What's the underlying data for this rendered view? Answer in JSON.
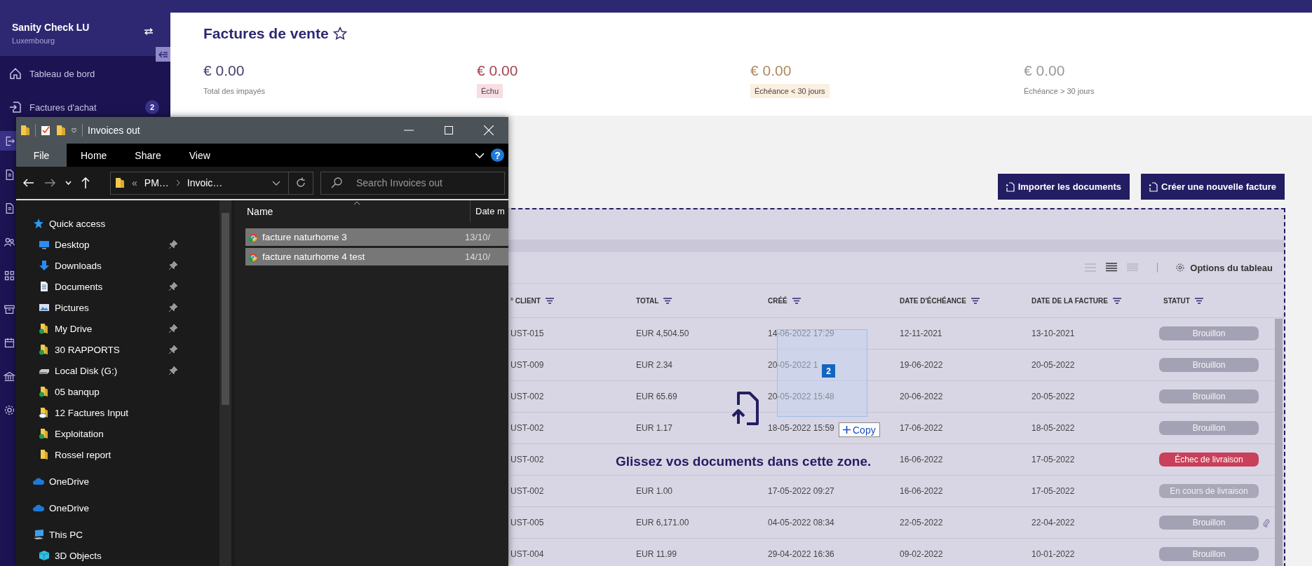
{
  "sidebar": {
    "company": "Sanity Check LU",
    "country": "Luxembourg",
    "items": [
      {
        "label": "Tableau de bord",
        "kind": "home",
        "selected": false
      },
      {
        "label": "Factures d'achat",
        "kind": "import",
        "badge": "2",
        "selected": false
      },
      {
        "kind": "export",
        "selected": true
      },
      {
        "kind": "document",
        "selected": false
      },
      {
        "kind": "document",
        "selected": false
      },
      {
        "kind": "people",
        "selected": false
      },
      {
        "kind": "grid",
        "selected": false
      },
      {
        "kind": "archive",
        "selected": false
      },
      {
        "kind": "calendar",
        "selected": false
      },
      {
        "kind": "bank",
        "selected": false
      },
      {
        "kind": "gear",
        "selected": false
      }
    ]
  },
  "page": {
    "title": "Factures de vente",
    "favorite": false,
    "stats": [
      {
        "amount": "€ 0.00",
        "label": "Total des impayés",
        "kind": "total"
      },
      {
        "amount": "€ 0.00",
        "label": "Échu",
        "kind": "overdue"
      },
      {
        "amount": "€ 0.00",
        "label": "Échéance < 30 jours",
        "kind": "soon"
      },
      {
        "amount": "€ 0.00",
        "label": "Échéance > 30 jours",
        "kind": "later"
      }
    ],
    "buttons": [
      "Importer les documents",
      "Créer une nouvelle facture"
    ]
  },
  "table": {
    "density": [
      {
        "selected": false
      },
      {
        "selected": true
      },
      {
        "selected": false
      }
    ],
    "options_label": "Options du tableau",
    "columns": [
      "° CLIENT",
      "TOTAL",
      "CRÉÉ",
      "DATE D'ÉCHÉANCE",
      "DATE DE LA FACTURE",
      "STATUT"
    ],
    "rows": [
      {
        "client": "UST-015",
        "total": "EUR 4,504.50",
        "created": "14-06-2022 17:29",
        "due": "12-11-2021",
        "date": "13-10-2021",
        "status": {
          "label": "Brouillon",
          "kind": "draft"
        },
        "attachment": false
      },
      {
        "client": "UST-009",
        "total": "EUR 2.34",
        "created": "20-05-2022 1",
        "due": "19-06-2022",
        "date": "20-05-2022",
        "status": {
          "label": "Brouillon",
          "kind": "draft"
        },
        "attachment": false
      },
      {
        "client": "UST-002",
        "total": "EUR 65.69",
        "created": "20-05-2022 15:48",
        "due": "20-06-2022",
        "date": "20-05-2022",
        "status": {
          "label": "Brouillon",
          "kind": "draft"
        },
        "attachment": false
      },
      {
        "client": "UST-002",
        "total": "EUR 1.17",
        "created": "18-05-2022 15:59",
        "due": "17-06-2022",
        "date": "18-05-2022",
        "status": {
          "label": "Brouillon",
          "kind": "draft"
        },
        "attachment": false
      },
      {
        "client": "UST-002",
        "due": "16-06-2022",
        "date": "17-05-2022",
        "status": {
          "label": "Échec de livraison",
          "kind": "failed"
        },
        "attachment": false
      },
      {
        "client": "UST-002",
        "total": "EUR 1.00",
        "created": "17-05-2022 09:27",
        "due": "16-06-2022",
        "date": "17-05-2022",
        "status": {
          "label": "En cours de livraison",
          "kind": "in_progress"
        },
        "attachment": false
      },
      {
        "client": "UST-005",
        "total": "EUR 6,171.00",
        "created": "04-05-2022 08:34",
        "due": "22-05-2022",
        "date": "22-04-2022",
        "status": {
          "label": "Brouillon",
          "kind": "draft"
        },
        "attachment": true
      },
      {
        "client": "UST-004",
        "total": "EUR 11.99",
        "created": "29-04-2022 16:36",
        "due": "09-02-2022",
        "date": "10-01-2022",
        "status": {
          "label": "Brouillon",
          "kind": "draft"
        },
        "attachment": false
      }
    ]
  },
  "drop_zone": {
    "message": "Glissez vos documents dans cette zone.",
    "drag_count": "2",
    "drag_action": "Copy"
  },
  "explorer": {
    "title": "Invoices out",
    "help": "?",
    "tabs": [
      {
        "label": "File",
        "selected": true
      },
      {
        "label": "Home",
        "selected": false
      },
      {
        "label": "Share",
        "selected": false
      },
      {
        "label": "View",
        "selected": false
      }
    ],
    "path_overflow": "«",
    "path": [
      "PM…",
      "Invoic…"
    ],
    "search_placeholder": "Search Invoices out",
    "nav": [
      {
        "label": "Quick access",
        "kind": "star",
        "children": [
          {
            "label": "Desktop",
            "kind": "desktop",
            "pinned": true
          },
          {
            "label": "Downloads",
            "kind": "download",
            "pinned": true
          },
          {
            "label": "Documents",
            "kind": "documents",
            "pinned": true
          },
          {
            "label": "Pictures",
            "kind": "pictures",
            "pinned": true
          },
          {
            "label": "My Drive",
            "kind": "synced",
            "pinned": true
          },
          {
            "label": "30 RAPPORTS",
            "kind": "synced",
            "pinned": true
          },
          {
            "label": "Local Disk (G:)",
            "kind": "disk",
            "pinned": true
          },
          {
            "label": "05 banqup",
            "kind": "synced",
            "pinned": false
          },
          {
            "label": "12 Factures Input",
            "kind": "cloud_folder",
            "pinned": false
          },
          {
            "label": "Exploitation",
            "kind": "synced",
            "pinned": false
          },
          {
            "label": "Rossel report",
            "kind": "folder",
            "pinned": false
          }
        ]
      },
      {
        "label": "OneDrive",
        "kind": "cloud"
      },
      {
        "label": "OneDrive",
        "kind": "cloud"
      },
      {
        "label": "This PC",
        "kind": "pc",
        "children": [
          {
            "label": "3D Objects",
            "kind": "cube",
            "pinned": false
          }
        ]
      }
    ],
    "columns": [
      "Name",
      "Date m"
    ],
    "files": [
      {
        "name": "facture naturhome 3",
        "date": "13/10/",
        "selected": true
      },
      {
        "name": "facture naturhome 4 test",
        "date": "14/10/",
        "selected": true
      }
    ]
  }
}
